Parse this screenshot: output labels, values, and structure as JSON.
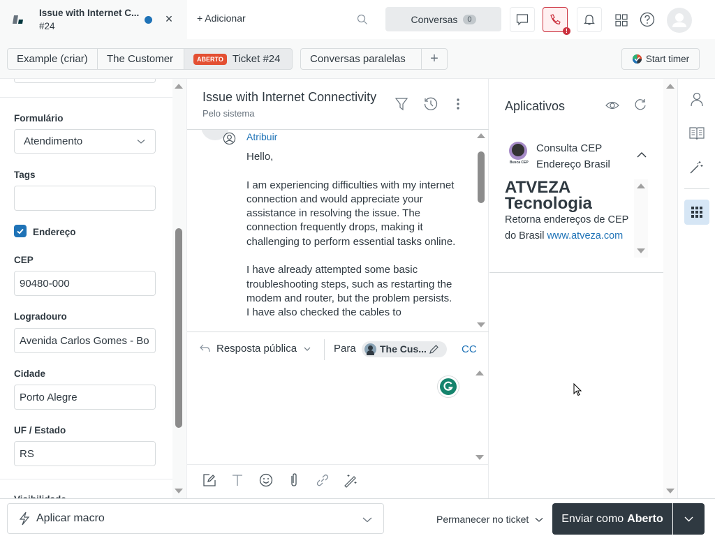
{
  "top_tab": {
    "title": "Issue with Internet C...",
    "subtitle": "#24"
  },
  "topbar": {
    "add_label": "+ Adicionar",
    "conversations_label": "Conversas",
    "conversations_count": "0",
    "phone_alert": "!"
  },
  "context_tabs": [
    {
      "label": "Example (criar)"
    },
    {
      "label": "The Customer"
    },
    {
      "label": "Ticket #24",
      "badge": "ABERTO"
    },
    {
      "label": "Conversas paralelas"
    },
    {
      "label": "+"
    }
  ],
  "start_timer_label": "Start timer",
  "left_panel": {
    "form_label": "Formulário",
    "form_value": "Atendimento",
    "tags_label": "Tags",
    "tags_value": "",
    "address_checkbox_label": "Endereço",
    "address_checked": true,
    "cep_label": "CEP",
    "cep_value": "90480-000",
    "street_label": "Logradouro",
    "street_value": "Avenida Carlos Gomes - Bo",
    "city_label": "Cidade",
    "city_value": "Porto Alegre",
    "state_label": "UF / Estado",
    "state_value": "RS",
    "cut_label": "Visibilidade"
  },
  "conversation": {
    "title": "Issue with Internet Connectivity",
    "subtitle": "Pelo sistema",
    "assign_link": "Atribuir",
    "message_paragraphs": [
      "Hello,",
      "I am experiencing difficulties with my internet connection and would appreciate your assistance in resolving the issue. The connection frequently drops, making it challenging to perform essential tasks online.",
      "I have already attempted some basic troubleshooting steps, such as restarting the modem and router, but the problem persists. I have also checked the cables to"
    ]
  },
  "reply": {
    "type_label": "Resposta pública",
    "to_label": "Para",
    "recipient": "The Cus...",
    "cc_label": "CC"
  },
  "apps_panel": {
    "title": "Aplicativos",
    "app_name_line1": "Consulta CEP",
    "app_name_line2": "Endereço Brasil",
    "app_logo_caption": "Busca CEP",
    "company_line1": "ATVEZA",
    "company_line2": "Tecnologia",
    "description": "Retorna endereços de CEP do Brasil",
    "link": "www.atveza.com"
  },
  "footer": {
    "macro_label": "Aplicar macro",
    "stay_label": "Permanecer no ticket",
    "send_prefix": "Enviar como",
    "send_status": "Aberto"
  }
}
